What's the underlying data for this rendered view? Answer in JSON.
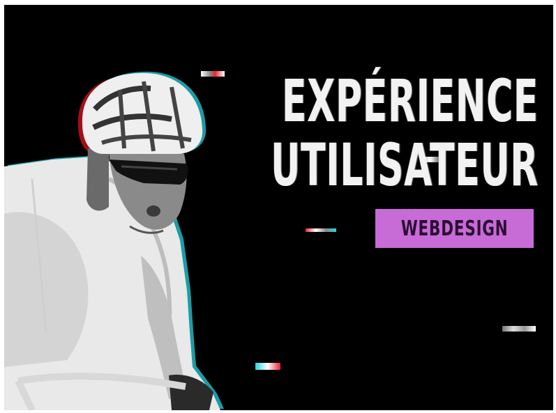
{
  "headline": {
    "line1": "EXPÉRIENCE",
    "line2": "UTILISATEUR"
  },
  "tag": {
    "label": "WEBDESIGN",
    "color": "#c76bd6"
  },
  "colors": {
    "background": "#000000",
    "text": "#f2f2f2",
    "glitch_cyan": "#29d6e0",
    "glitch_red": "#e0222c"
  },
  "illustration": {
    "subject": "cyclist-with-helmet-and-sunglasses"
  }
}
